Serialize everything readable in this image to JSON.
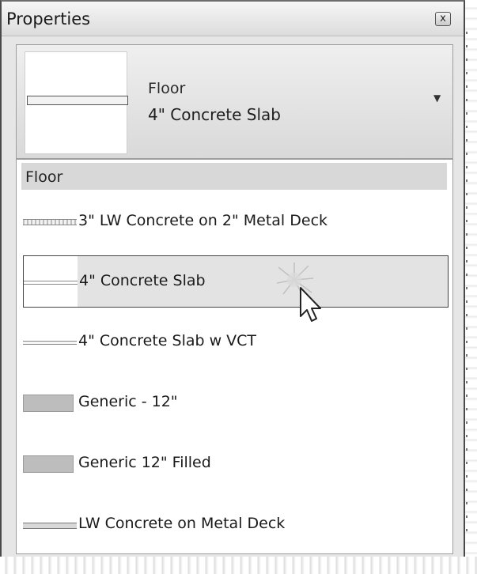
{
  "window": {
    "title": "Properties",
    "close_glyph": "x"
  },
  "type_selector": {
    "category": "Floor",
    "type_name": "4\" Concrete Slab",
    "arrow_glyph": "▼"
  },
  "dropdown": {
    "group_header": "Floor",
    "items": [
      {
        "label": "3\" LW Concrete on 2\" Metal Deck",
        "swatch": "hatched-thin",
        "selected": false
      },
      {
        "label": "4\" Concrete Slab",
        "swatch": "thin-line",
        "selected": true
      },
      {
        "label": "4\" Concrete Slab w VCT",
        "swatch": "thin-line",
        "selected": false
      },
      {
        "label": "Generic - 12\"",
        "swatch": "filled-block",
        "selected": false
      },
      {
        "label": "Generic   12\"    Filled",
        "swatch": "filled-block",
        "selected": false
      },
      {
        "label": "LW Concrete on Metal Deck",
        "swatch": "thin-deck",
        "selected": false
      }
    ]
  },
  "icons": {
    "close": "close-icon",
    "dropdown": "chevron-down-icon",
    "cursor": "mouse-pointer-icon"
  }
}
